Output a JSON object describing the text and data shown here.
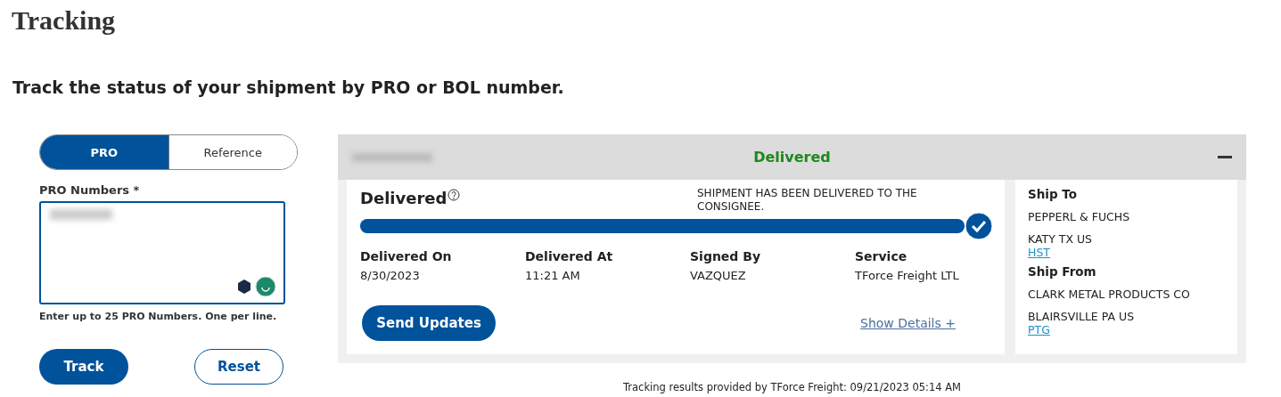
{
  "page_title": "Tracking",
  "subtitle": "Track the status of your shipment by PRO or BOL number.",
  "search_tabs": [
    {
      "label": "PRO",
      "selected": true
    },
    {
      "label": "Reference",
      "selected": false
    }
  ],
  "pro_numbers": {
    "label": "PRO Numbers *",
    "hint": "Enter up to 25 PRO Numbers. One per line."
  },
  "buttons": {
    "track": "Track",
    "reset": "Reset"
  },
  "result": {
    "header_status": "Delivered",
    "expanded": true,
    "status": "Delivered",
    "message": "SHIPMENT HAS BEEN DELIVERED TO THE CONSIGNEE.",
    "level": 1,
    "details": [
      {
        "label": "Delivered On",
        "value": "8/30/2023"
      },
      {
        "label": "Delivered At",
        "value": "11:21 AM"
      },
      {
        "label": "Signed By",
        "value": "VAZQUEZ"
      },
      {
        "label": "Service",
        "value": "TForce Freight LTL"
      }
    ],
    "send_updates": "Send Updates",
    "show_details": "Show Details +",
    "ship_to": {
      "heading": "Ship To",
      "name": "PEPPERL & FUCHS",
      "location": "KATY TX US",
      "terminal": "HST"
    },
    "ship_from": {
      "heading": "Ship From",
      "name": "CLARK METAL PRODUCTS CO",
      "location": "BLAIRSVILLE PA US",
      "terminal": "PTG"
    }
  },
  "footer": "Tracking results provided by TForce Freight: 09/21/2023 05:14 AM"
}
